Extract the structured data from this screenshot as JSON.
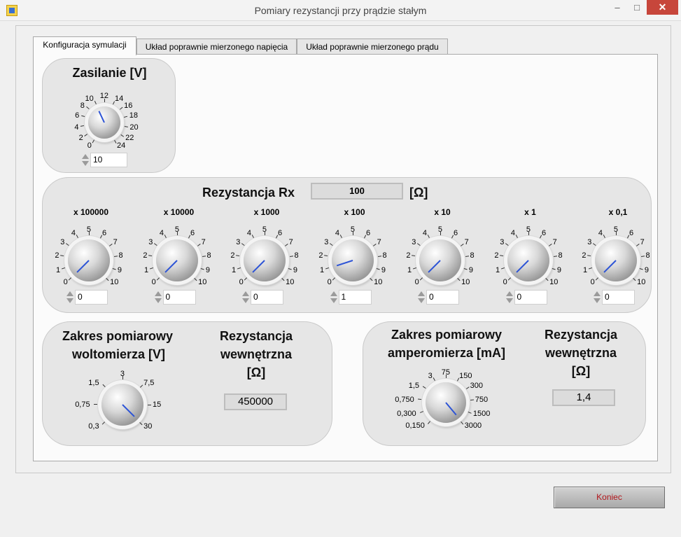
{
  "window": {
    "title": "Pomiary rezystancji przy prądzie stałym",
    "minimize": "–",
    "maximize": "□",
    "close": "✕",
    "app_icon": "labview-vi-icon"
  },
  "tabs": [
    {
      "label": "Konfiguracja symulacji",
      "active": true
    },
    {
      "label": "Układ poprawnie mierzonego napięcia",
      "active": false
    },
    {
      "label": "Układ poprawnie mierzonego prądu",
      "active": false
    }
  ],
  "supply": {
    "label": "Zasilanie [V]",
    "scale": [
      "0",
      "2",
      "4",
      "6",
      "8",
      "10",
      "12",
      "14",
      "16",
      "18",
      "20",
      "22",
      "24"
    ],
    "value": "10"
  },
  "resistance": {
    "label": "Rezystancja Rx",
    "value": "100",
    "unit": "[Ω]",
    "scale": [
      "0",
      "1",
      "2",
      "3",
      "4",
      "5",
      "6",
      "7",
      "8",
      "9",
      "10"
    ],
    "decades": [
      {
        "label": "x 100000",
        "value": "0",
        "knob_value": 0
      },
      {
        "label": "x 10000",
        "value": "0",
        "knob_value": 0
      },
      {
        "label": "x 1000",
        "value": "0",
        "knob_value": 0
      },
      {
        "label": "x 100",
        "value": "1",
        "knob_value": 1
      },
      {
        "label": "x 10",
        "value": "0",
        "knob_value": 0
      },
      {
        "label": "x 1",
        "value": "0",
        "knob_value": 0
      },
      {
        "label": "x 0,1",
        "value": "0",
        "knob_value": 0
      }
    ]
  },
  "voltmeter": {
    "range_label_1": "Zakres pomiarowy",
    "range_label_2": "woltomierza [V]",
    "scale": [
      "0,3",
      "0,75",
      "1,5",
      "3",
      "7,5",
      "15",
      "30"
    ],
    "selected": "30",
    "internal_label_1": "Rezystancja",
    "internal_label_2": "wewnętrzna",
    "internal_label_3": "[Ω]",
    "internal_value": "450000"
  },
  "ammeter": {
    "range_label_1": "Zakres pomiarowy",
    "range_label_2": "amperomierza [mA]",
    "scale": [
      "0,150",
      "0,300",
      "0,750",
      "1,5",
      "3",
      "75",
      "150",
      "300",
      "750",
      "1500",
      "3000"
    ],
    "selected": "3000",
    "internal_label_1": "Rezystancja",
    "internal_label_2": "wewnętrzna",
    "internal_label_3": "[Ω]",
    "internal_value": "1,4"
  },
  "footer": {
    "stop_label": "Koniec"
  },
  "colors": {
    "pointer": "#2d54d6",
    "stop_text": "#b1161c",
    "close_button": "#c7463b"
  }
}
